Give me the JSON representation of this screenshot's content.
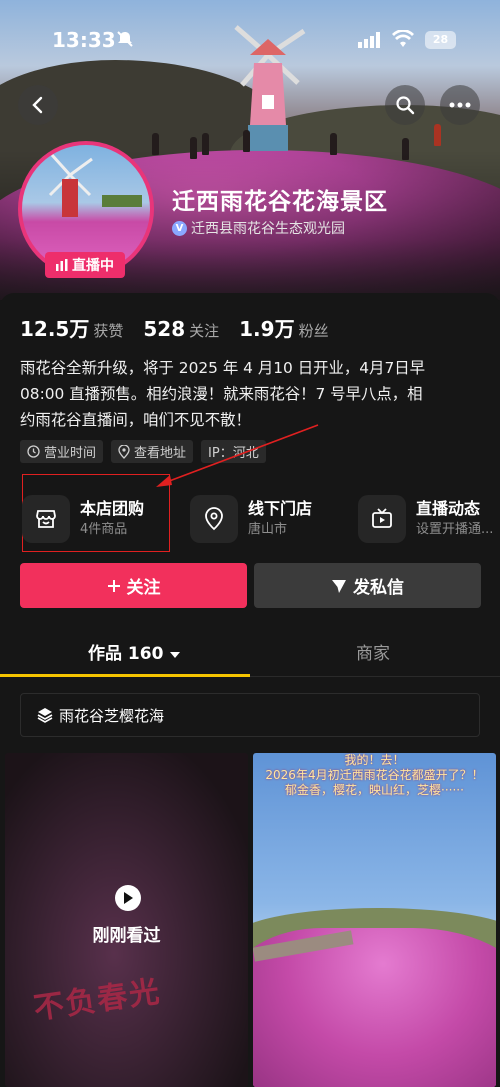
{
  "status_bar": {
    "time": "13:33",
    "battery": "28"
  },
  "profile": {
    "name": "迁西雨花谷花海景区",
    "verified_entity": "迁西县雨花谷生态观光园",
    "live_label": "直播中"
  },
  "stats": [
    {
      "value": "12.5万",
      "label": "获赞"
    },
    {
      "value": "528",
      "label": "关注"
    },
    {
      "value": "1.9万",
      "label": "粉丝"
    }
  ],
  "bio_lines": [
    "雨花谷全新升级，将于 2025 年 4 月10 日开业，4月7日早",
    "08:00 直播预售。相约浪漫！就来雨花谷！7 号早八点，相",
    "约雨花谷直播间，咱们不见不散！"
  ],
  "tags": [
    {
      "icon": "clock-icon",
      "label": "营业时间"
    },
    {
      "icon": "location-icon",
      "label": "查看地址"
    },
    {
      "icon": "",
      "label": "IP：河北"
    }
  ],
  "quick_links": [
    {
      "icon": "shop-icon",
      "title": "本店团购",
      "subtitle": "4件商品"
    },
    {
      "icon": "pin-icon",
      "title": "线下门店",
      "subtitle": "唐山市"
    },
    {
      "icon": "live-tv-icon",
      "title": "直播动态",
      "subtitle": "设置开播通..."
    }
  ],
  "buttons": {
    "follow": "关注",
    "message": "发私信"
  },
  "tabs": {
    "works": "作品 160",
    "merchant": "商家"
  },
  "collection": {
    "label": "雨花谷芝樱花海"
  },
  "videos": [
    {
      "overlay": "刚刚看过",
      "watermark": "不负春光"
    },
    {
      "caption_lines": [
        "我的！去！",
        "2026年4月初迁西雨花谷花都盛开了？！",
        "郁金香，樱花，映山红，芝樱······"
      ]
    }
  ],
  "colors": {
    "accent": "#f2305c",
    "live_badge": "#ee2e6b",
    "tab_underline": "#f5c400",
    "annotation": "#e02020"
  }
}
